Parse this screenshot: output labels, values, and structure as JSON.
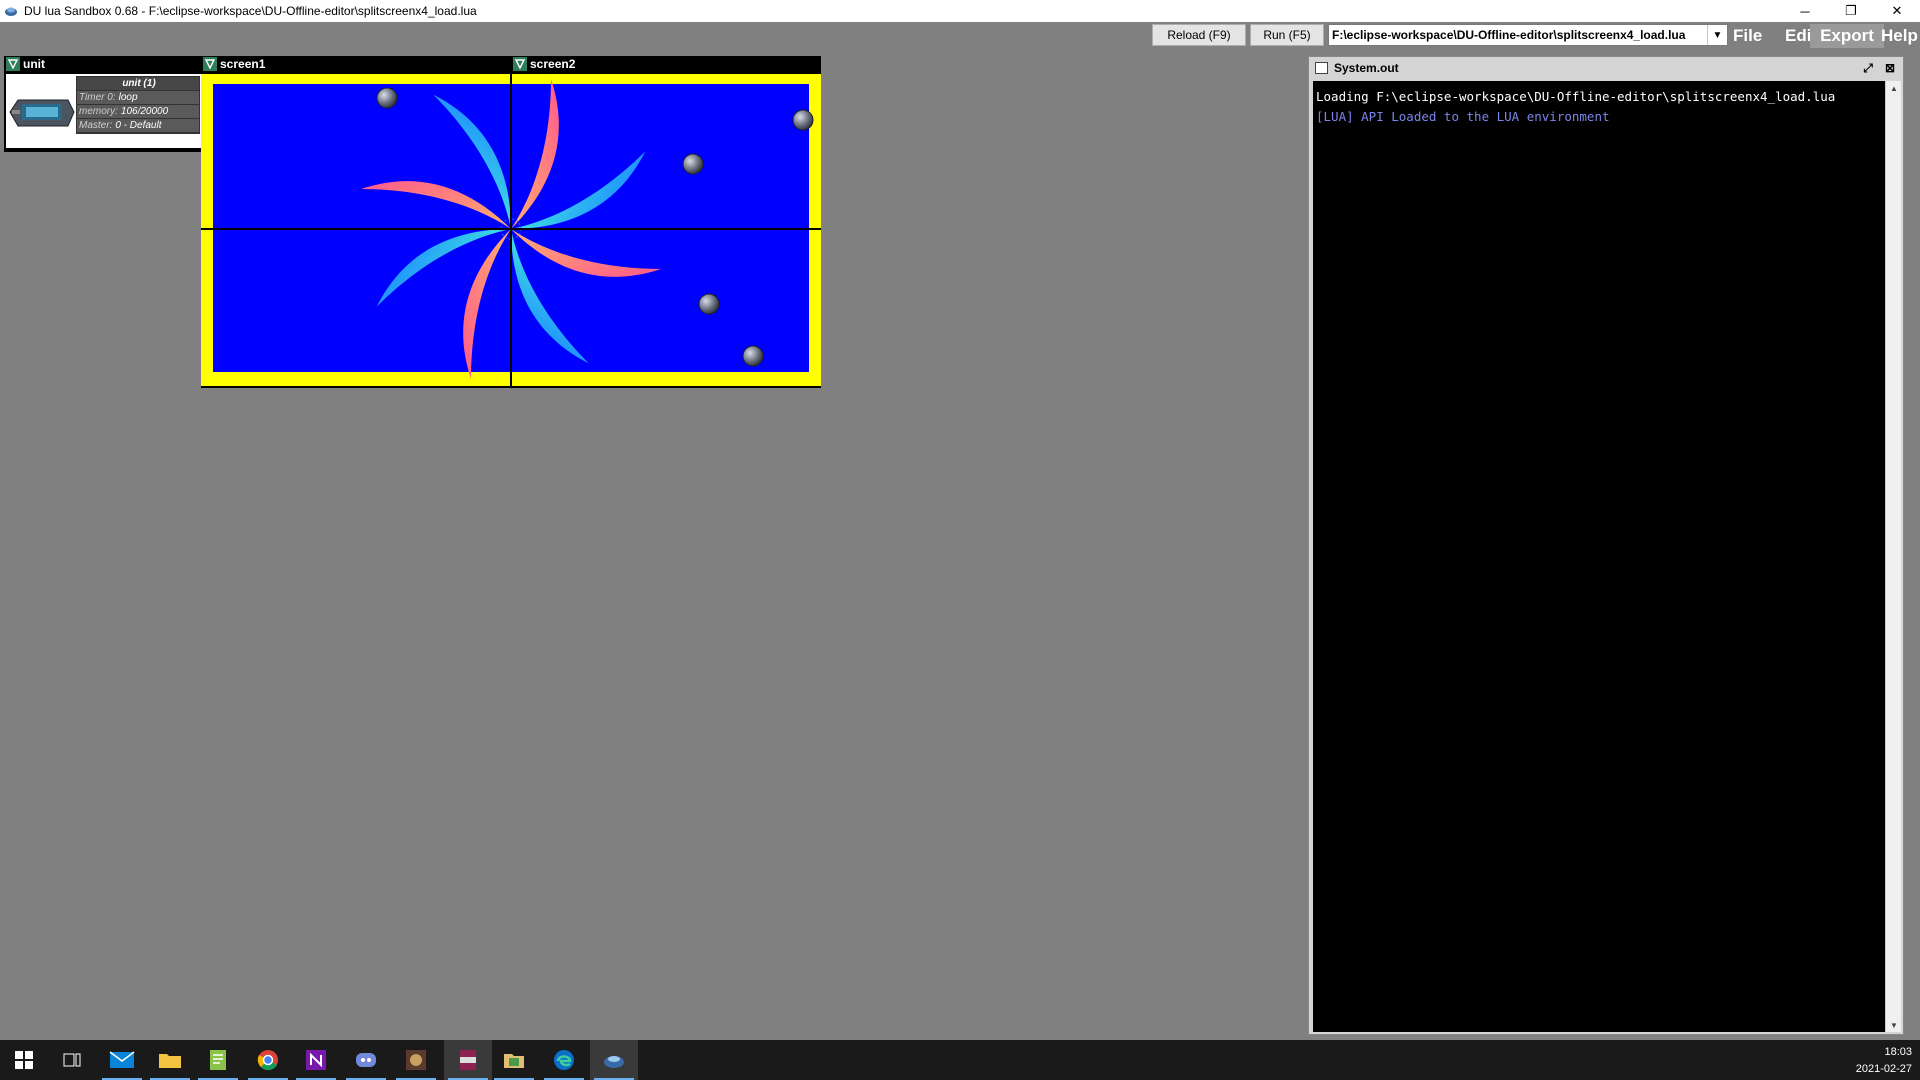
{
  "window": {
    "title": "DU lua Sandbox 0.68 - F:\\eclipse-workspace\\DU-Offline-editor\\splitscreenx4_load.lua",
    "minimize": "─",
    "restore": "❐",
    "close": "✕"
  },
  "toolbar": {
    "reload_label": "Reload (F9)",
    "run_label": "Run (F5)",
    "file_path": "F:\\eclipse-workspace\\DU-Offline-editor\\splitscreenx4_load.lua",
    "dropdown_glyph": "▼",
    "menu": [
      "File",
      "Edit",
      "Export",
      "Help"
    ]
  },
  "widgets": {
    "unit": {
      "title": "unit",
      "info_title": "unit (1)",
      "rows": [
        {
          "key": "Timer 0:",
          "value": "loop"
        },
        {
          "key": "memory:",
          "value": "106/20000"
        },
        {
          "key": "Master:",
          "value": "0 - Default"
        }
      ]
    },
    "screen1": {
      "title": "screen1"
    },
    "screen2": {
      "title": "screen2"
    }
  },
  "sysout": {
    "title": "System.out",
    "lines": [
      {
        "text": "Loading F:\\eclipse-workspace\\DU-Offline-editor\\splitscreenx4_load.lua",
        "color": "#ffffff"
      },
      {
        "text": "[LUA] API Loaded to the LUA environment",
        "color": "#7a86e8"
      }
    ]
  },
  "screen_colors": {
    "border": "#ffff00",
    "background": "#0000ff"
  },
  "taskbar": {
    "icons": [
      "windows-start-icon",
      "task-view-icon",
      "mail-icon",
      "file-explorer-icon",
      "notepad-icon",
      "chrome-icon",
      "onenote-icon",
      "discord-icon",
      "game-icon",
      "winrar-icon",
      "file-manager-icon",
      "edge-icon",
      "java-sandbox-icon"
    ],
    "time": "18:03",
    "date": "2021-02-27"
  }
}
